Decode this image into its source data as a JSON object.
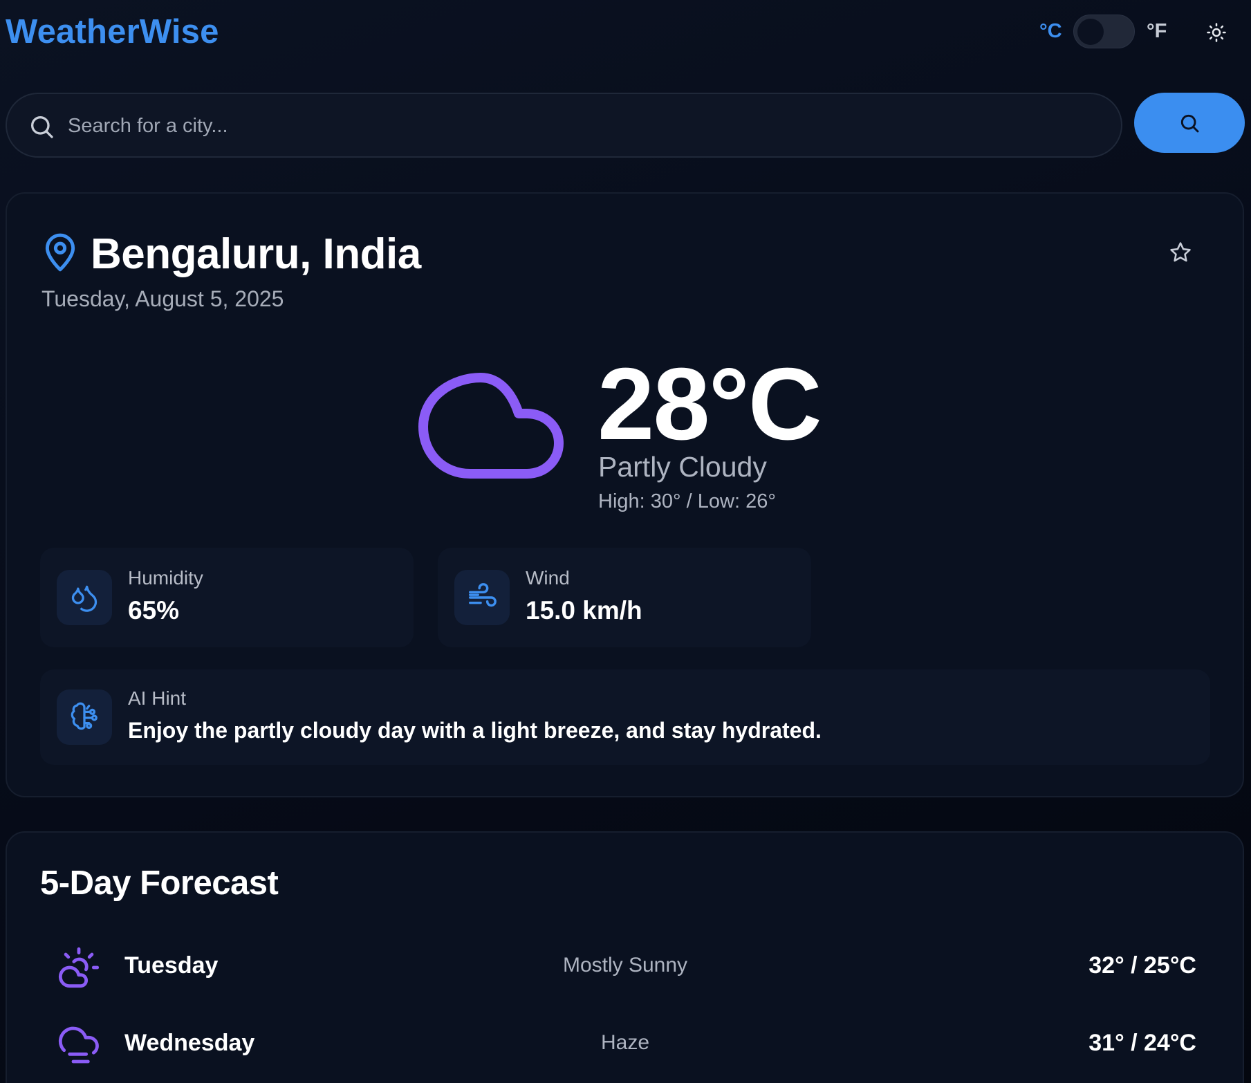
{
  "app": {
    "title": "WeatherWise"
  },
  "header": {
    "unit_c": "°C",
    "unit_f": "°F",
    "unit_toggle_state": "celsius",
    "theme_icon": "sun-icon"
  },
  "search": {
    "placeholder": "Search for a city...",
    "value": ""
  },
  "current": {
    "city": "Bengaluru, India",
    "date": "Tuesday, August 5, 2025",
    "temperature": "28°C",
    "condition": "Partly Cloudy",
    "high_low": "High: 30° / Low: 26°",
    "humidity": {
      "label": "Humidity",
      "value": "65%"
    },
    "wind": {
      "label": "Wind",
      "value": "15.0 km/h"
    },
    "ai_hint": {
      "label": "AI Hint",
      "text": "Enjoy the partly cloudy day with a light breeze, and stay hydrated."
    }
  },
  "forecast": {
    "title": "5-Day Forecast",
    "days": [
      {
        "day": "Tuesday",
        "condition": "Mostly Sunny",
        "temps": "32° / 25°C",
        "icon": "partly-sunny-icon"
      },
      {
        "day": "Wednesday",
        "condition": "Haze",
        "temps": "31° / 24°C",
        "icon": "haze-icon"
      }
    ]
  },
  "colors": {
    "accent": "#3d8ff0",
    "icon_purple": "#8b5cf6",
    "background": "#060b17",
    "card": "#0a1120"
  }
}
